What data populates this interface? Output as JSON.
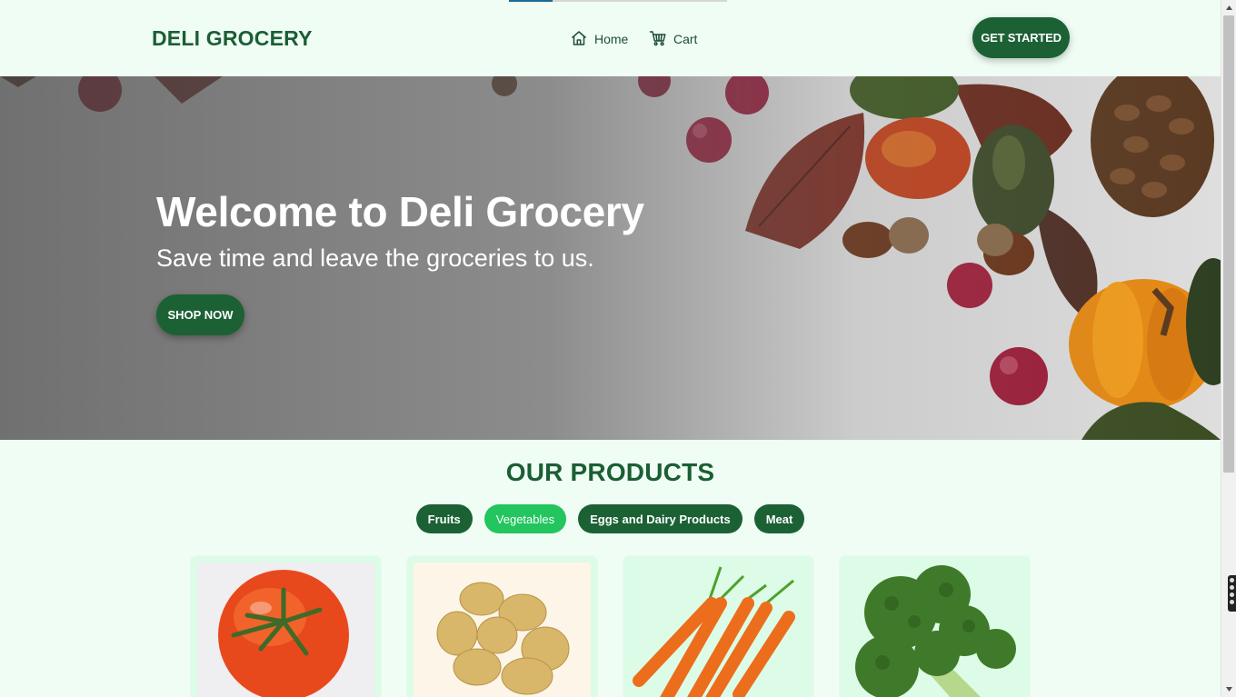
{
  "nav": {
    "brand": "DELI GROCERY",
    "links": [
      {
        "label": "Home",
        "icon": "home-icon"
      },
      {
        "label": "Cart",
        "icon": "cart-icon"
      }
    ],
    "cta_label": "GET STARTED",
    "load_progress": 0.2
  },
  "hero": {
    "title": "Welcome to Deli Grocery",
    "subtitle": "Save time and leave the groceries to us.",
    "button_label": "SHOP NOW",
    "background": "autumn-produce-photo"
  },
  "products": {
    "title": "OUR PRODUCTS",
    "filters": [
      {
        "label": "Fruits",
        "active": false
      },
      {
        "label": "Vegetables",
        "active": true
      },
      {
        "label": "Eggs and Dairy Products",
        "active": false
      },
      {
        "label": "Meat",
        "active": false
      }
    ],
    "items": [
      {
        "image": "tomato-image"
      },
      {
        "image": "potatoes-image"
      },
      {
        "image": "carrots-image"
      },
      {
        "image": "broccoli-image"
      }
    ]
  },
  "colors": {
    "brand_green": "#1b6134",
    "accent_green": "#22c55e",
    "page_bg": "#effdf4",
    "card_bg": "#dcfce7"
  }
}
